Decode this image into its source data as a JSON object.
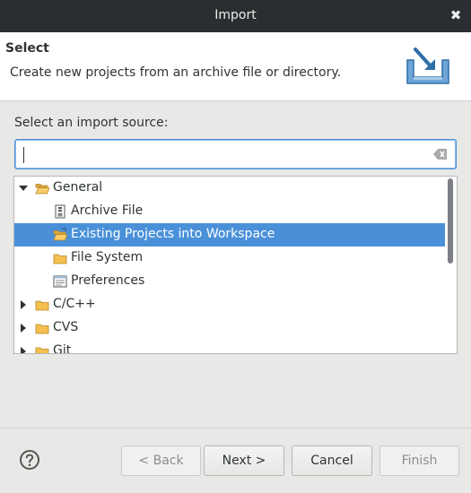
{
  "window": {
    "title": "Import",
    "close_glyph": "✖"
  },
  "header": {
    "title": "Select",
    "description": "Create new projects from an archive file or directory.",
    "icon": "import-wizard-icon"
  },
  "source": {
    "label": "Select an import source:",
    "filter_value": "",
    "clear_icon": "clear-text-icon"
  },
  "tree": {
    "items": [
      {
        "label": "General",
        "expanded": true,
        "depth": 0,
        "icon": "folder-open-icon"
      },
      {
        "label": "Archive File",
        "depth": 1,
        "icon": "archive-file-icon"
      },
      {
        "label": "Existing Projects into Workspace",
        "depth": 1,
        "icon": "existing-projects-icon",
        "selected": true
      },
      {
        "label": "File System",
        "depth": 1,
        "icon": "folder-icon"
      },
      {
        "label": "Preferences",
        "depth": 1,
        "icon": "preferences-icon"
      },
      {
        "label": "C/C++",
        "expanded": false,
        "depth": 0,
        "icon": "folder-icon"
      },
      {
        "label": "CVS",
        "expanded": false,
        "depth": 0,
        "icon": "folder-icon"
      },
      {
        "label": "Git",
        "expanded": false,
        "depth": 0,
        "icon": "folder-icon"
      }
    ]
  },
  "buttons": {
    "back": "< Back",
    "next": "Next >",
    "cancel": "Cancel",
    "finish": "Finish"
  },
  "colors": {
    "selection": "#4a90d9",
    "titlebar": "#2b2e30",
    "folder": "#f5c04f"
  }
}
